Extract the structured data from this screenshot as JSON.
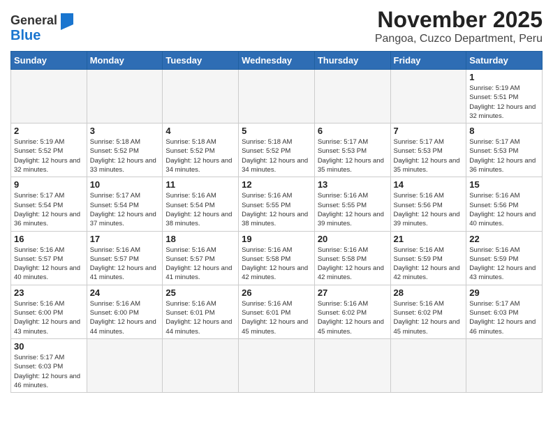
{
  "header": {
    "logo_general": "General",
    "logo_blue": "Blue",
    "month": "November 2025",
    "location": "Pangoa, Cuzco Department, Peru"
  },
  "weekdays": [
    "Sunday",
    "Monday",
    "Tuesday",
    "Wednesday",
    "Thursday",
    "Friday",
    "Saturday"
  ],
  "days": [
    {
      "date": "",
      "info": ""
    },
    {
      "date": "",
      "info": ""
    },
    {
      "date": "",
      "info": ""
    },
    {
      "date": "",
      "info": ""
    },
    {
      "date": "",
      "info": ""
    },
    {
      "date": "",
      "info": ""
    },
    {
      "date": "1",
      "sunrise": "5:19 AM",
      "sunset": "5:51 PM",
      "daylight": "12 hours and 32 minutes."
    },
    {
      "date": "2",
      "sunrise": "5:19 AM",
      "sunset": "5:52 PM",
      "daylight": "12 hours and 32 minutes."
    },
    {
      "date": "3",
      "sunrise": "5:18 AM",
      "sunset": "5:52 PM",
      "daylight": "12 hours and 33 minutes."
    },
    {
      "date": "4",
      "sunrise": "5:18 AM",
      "sunset": "5:52 PM",
      "daylight": "12 hours and 34 minutes."
    },
    {
      "date": "5",
      "sunrise": "5:18 AM",
      "sunset": "5:52 PM",
      "daylight": "12 hours and 34 minutes."
    },
    {
      "date": "6",
      "sunrise": "5:17 AM",
      "sunset": "5:53 PM",
      "daylight": "12 hours and 35 minutes."
    },
    {
      "date": "7",
      "sunrise": "5:17 AM",
      "sunset": "5:53 PM",
      "daylight": "12 hours and 35 minutes."
    },
    {
      "date": "8",
      "sunrise": "5:17 AM",
      "sunset": "5:53 PM",
      "daylight": "12 hours and 36 minutes."
    },
    {
      "date": "9",
      "sunrise": "5:17 AM",
      "sunset": "5:54 PM",
      "daylight": "12 hours and 36 minutes."
    },
    {
      "date": "10",
      "sunrise": "5:17 AM",
      "sunset": "5:54 PM",
      "daylight": "12 hours and 37 minutes."
    },
    {
      "date": "11",
      "sunrise": "5:16 AM",
      "sunset": "5:54 PM",
      "daylight": "12 hours and 38 minutes."
    },
    {
      "date": "12",
      "sunrise": "5:16 AM",
      "sunset": "5:55 PM",
      "daylight": "12 hours and 38 minutes."
    },
    {
      "date": "13",
      "sunrise": "5:16 AM",
      "sunset": "5:55 PM",
      "daylight": "12 hours and 39 minutes."
    },
    {
      "date": "14",
      "sunrise": "5:16 AM",
      "sunset": "5:56 PM",
      "daylight": "12 hours and 39 minutes."
    },
    {
      "date": "15",
      "sunrise": "5:16 AM",
      "sunset": "5:56 PM",
      "daylight": "12 hours and 40 minutes."
    },
    {
      "date": "16",
      "sunrise": "5:16 AM",
      "sunset": "5:57 PM",
      "daylight": "12 hours and 40 minutes."
    },
    {
      "date": "17",
      "sunrise": "5:16 AM",
      "sunset": "5:57 PM",
      "daylight": "12 hours and 41 minutes."
    },
    {
      "date": "18",
      "sunrise": "5:16 AM",
      "sunset": "5:57 PM",
      "daylight": "12 hours and 41 minutes."
    },
    {
      "date": "19",
      "sunrise": "5:16 AM",
      "sunset": "5:58 PM",
      "daylight": "12 hours and 42 minutes."
    },
    {
      "date": "20",
      "sunrise": "5:16 AM",
      "sunset": "5:58 PM",
      "daylight": "12 hours and 42 minutes."
    },
    {
      "date": "21",
      "sunrise": "5:16 AM",
      "sunset": "5:59 PM",
      "daylight": "12 hours and 42 minutes."
    },
    {
      "date": "22",
      "sunrise": "5:16 AM",
      "sunset": "5:59 PM",
      "daylight": "12 hours and 43 minutes."
    },
    {
      "date": "23",
      "sunrise": "5:16 AM",
      "sunset": "6:00 PM",
      "daylight": "12 hours and 43 minutes."
    },
    {
      "date": "24",
      "sunrise": "5:16 AM",
      "sunset": "6:00 PM",
      "daylight": "12 hours and 44 minutes."
    },
    {
      "date": "25",
      "sunrise": "5:16 AM",
      "sunset": "6:01 PM",
      "daylight": "12 hours and 44 minutes."
    },
    {
      "date": "26",
      "sunrise": "5:16 AM",
      "sunset": "6:01 PM",
      "daylight": "12 hours and 45 minutes."
    },
    {
      "date": "27",
      "sunrise": "5:16 AM",
      "sunset": "6:02 PM",
      "daylight": "12 hours and 45 minutes."
    },
    {
      "date": "28",
      "sunrise": "5:16 AM",
      "sunset": "6:02 PM",
      "daylight": "12 hours and 45 minutes."
    },
    {
      "date": "29",
      "sunrise": "5:17 AM",
      "sunset": "6:03 PM",
      "daylight": "12 hours and 46 minutes."
    },
    {
      "date": "30",
      "sunrise": "5:17 AM",
      "sunset": "6:03 PM",
      "daylight": "12 hours and 46 minutes."
    }
  ],
  "labels": {
    "sunrise": "Sunrise:",
    "sunset": "Sunset:",
    "daylight": "Daylight:"
  }
}
